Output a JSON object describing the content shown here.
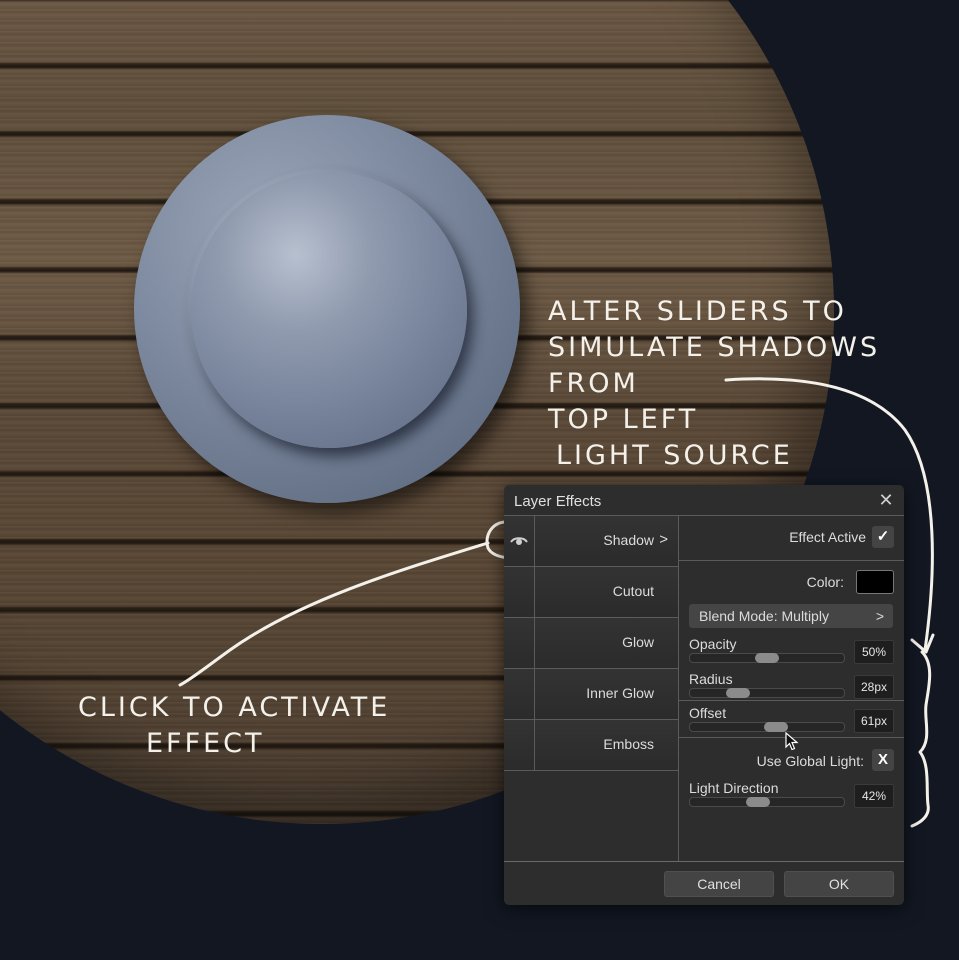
{
  "annotations": {
    "top_note": [
      "Alter sliders to",
      "simulate shadows from",
      "top left",
      "light source"
    ],
    "bottom_note": [
      "Click to activate",
      "effect"
    ]
  },
  "dialog": {
    "title": "Layer Effects",
    "close_icon": "close-icon",
    "effects": [
      {
        "label": "Shadow",
        "arrow": ">",
        "visible_icon": "eye-icon",
        "selected": true
      },
      {
        "label": "Cutout"
      },
      {
        "label": "Glow"
      },
      {
        "label": "Inner Glow"
      },
      {
        "label": "Emboss"
      }
    ],
    "properties": {
      "effect_active_label": "Effect Active",
      "effect_active_check": "✓",
      "color_label": "Color:",
      "color_value": "#000000",
      "blend_mode_label": "Blend Mode: Multiply",
      "blend_mode_arrow": ">",
      "opacity": {
        "label": "Opacity",
        "value": "50%",
        "fraction": 0.5
      },
      "radius": {
        "label": "Radius",
        "value": "28px",
        "fraction": 0.31
      },
      "offset": {
        "label": "Offset",
        "value": "61px",
        "fraction": 0.56
      },
      "use_global_light_label": "Use Global Light:",
      "use_global_light_value": "X",
      "light_direction": {
        "label": "Light Direction",
        "value": "42%",
        "fraction": 0.44
      }
    },
    "buttons": {
      "cancel": "Cancel",
      "ok": "OK"
    }
  }
}
